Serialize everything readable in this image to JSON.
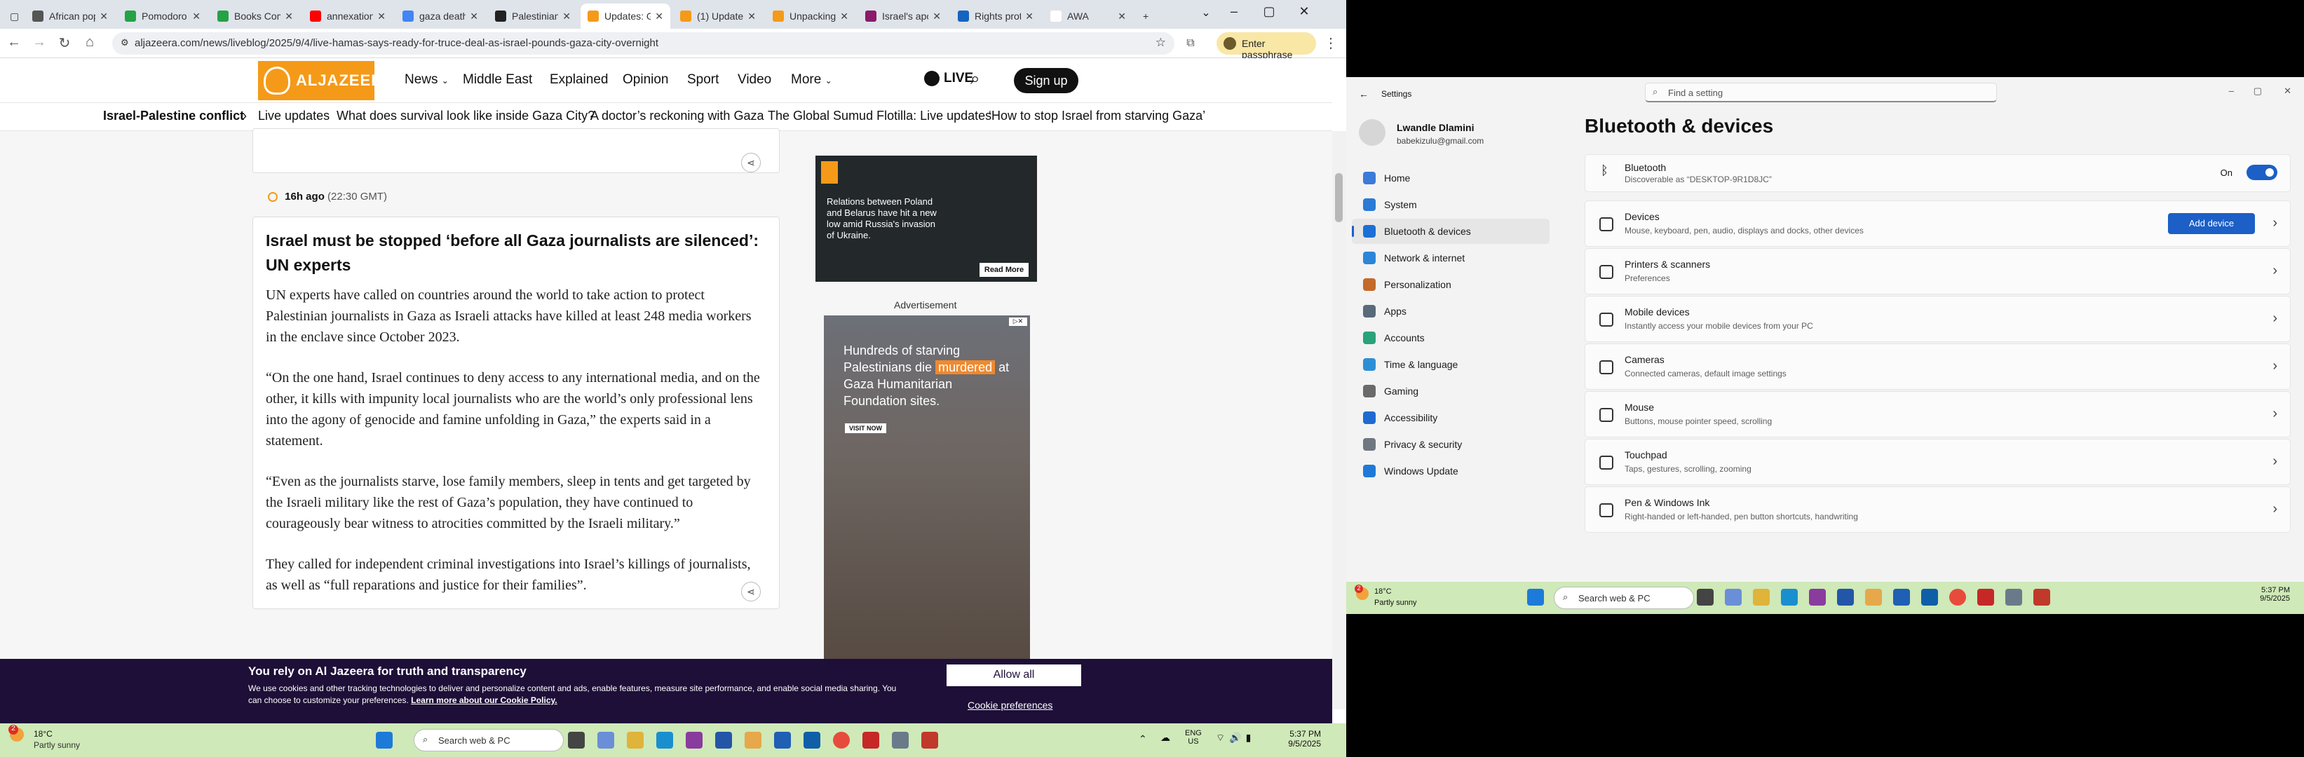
{
  "browser": {
    "tabs": [
      {
        "title": "African pop",
        "color": "#555"
      },
      {
        "title": "Pomodoro F",
        "color": "#25a244"
      },
      {
        "title": "Books Comp",
        "color": "#25a244"
      },
      {
        "title": "annexation",
        "color": "#ff0000"
      },
      {
        "title": "gaza death",
        "color": "#4285f4"
      },
      {
        "title": "Palestinian",
        "color": "#222"
      },
      {
        "title": "Updates: Ga",
        "color": "#f59a18"
      },
      {
        "title": "(1) Update",
        "color": "#f59a18"
      },
      {
        "title": "Unpacking t",
        "color": "#f59a18"
      },
      {
        "title": "Israel's apo",
        "color": "#8b1a6b"
      },
      {
        "title": "Rights prote",
        "color": "#1565c0"
      },
      {
        "title": "AWA",
        "color": "#ffffff"
      }
    ],
    "active_tab_index": 6,
    "url": "aljazeera.com/news/liveblog/2025/9/4/live-hamas-says-ready-for-truce-deal-as-israel-pounds-gaza-city-overnight",
    "passphrase_button": "Enter passphrase"
  },
  "header": {
    "logo_text": "ALJAZEERA",
    "nav": [
      "News",
      "Middle East",
      "Explained",
      "Opinion",
      "Sport",
      "Video",
      "More"
    ],
    "live_label": "LIVE",
    "signup_label": "Sign up"
  },
  "trending": {
    "label": "Israel-Palestine conflict",
    "links": [
      "Live updates",
      "What does survival look like inside Gaza City?",
      "A doctor’s reckoning with Gaza",
      "The Global Sumud Flotilla: Live updates",
      "‘How to stop Israel from starving Gaza’"
    ]
  },
  "post": {
    "time_ago": "16h ago",
    "time_gmt": "(22:30 GMT)",
    "title": "Israel must be stopped ‘before all Gaza journalists are silenced’: UN experts",
    "paragraphs": [
      "UN experts have called on countries around the world to take action to protect Palestinian journalists in Gaza as Israeli attacks have killed at least 248 media workers in the enclave since October 2023.",
      "“On the one hand, Israel continues to deny access to any international media, and on the other, it kills with impunity local journalists who are the world’s only professional lens into the agony of genocide and famine unfolding in Gaza,” the experts said in a statement.",
      "“Even as the journalists starve, lose family members, sleep in tents and get targeted by the Israeli military like the rest of Gaza’s population, they have continued to courageously bear witness to atrocities committed by the Israeli military.”",
      "They called for independent criminal investigations into Israel’s killings of journalists, as well as “full reparations and justice for their families”."
    ]
  },
  "ads": {
    "ad1_text": "Relations between Poland and Belarus have hit a new low amid Russia's invasion of Ukraine.",
    "ad1_button": "Read More",
    "label": "Advertisement",
    "ad2_pre": "Hundreds of starving Palestinians die",
    "ad2_highlight": "murdered",
    "ad2_post": "at Gaza Humanitarian Foundation sites.",
    "ad2_button": "VISIT NOW"
  },
  "cookie": {
    "title": "You rely on Al Jazeera for truth and transparency",
    "text": "We use cookies and other tracking technologies to deliver and personalize content and ads, enable features, measure site performance, and enable social media sharing. You can choose to customize your preferences.",
    "link": "Learn more about our Cookie Policy.",
    "allow_label": "Allow all",
    "prefs_label": "Cookie preferences"
  },
  "taskbar": {
    "weather_temp": "18°C",
    "weather_desc": "Partly sunny",
    "weather_badge": "2",
    "search_placeholder": "Search web & PC",
    "lang_top": "ENG",
    "lang_bottom": "US",
    "time": "5:37 PM",
    "date": "9/5/2025"
  },
  "settings": {
    "window_title": "Settings",
    "search_placeholder": "Find a setting",
    "user_name": "Lwandle Dlamini",
    "user_email": "babekizulu@gmail.com",
    "page_title": "Bluetooth & devices",
    "sidebar": [
      {
        "label": "Home",
        "color": "#3c7bd9"
      },
      {
        "label": "System",
        "color": "#2a7ad6"
      },
      {
        "label": "Bluetooth & devices",
        "color": "#1c6fd6"
      },
      {
        "label": "Network & internet",
        "color": "#2b86d8"
      },
      {
        "label": "Personalization",
        "color": "#c46a2a"
      },
      {
        "label": "Apps",
        "color": "#5a6a7a"
      },
      {
        "label": "Accounts",
        "color": "#2aa27a"
      },
      {
        "label": "Time & language",
        "color": "#2c8fd6"
      },
      {
        "label": "Gaming",
        "color": "#6a6a6a"
      },
      {
        "label": "Accessibility",
        "color": "#1f6ad1"
      },
      {
        "label": "Privacy & security",
        "color": "#6f7780"
      },
      {
        "label": "Windows Update",
        "color": "#1e7ad8"
      }
    ],
    "selected_index": 2,
    "bluetooth": {
      "title": "Bluetooth",
      "sub": "Discoverable as “DESKTOP-9R1D8JC”",
      "state": "On"
    },
    "rows": [
      {
        "title": "Devices",
        "sub": "Mouse, keyboard, pen, audio, displays and docks, other devices",
        "button": "Add device"
      },
      {
        "title": "Printers & scanners",
        "sub": "Preferences"
      },
      {
        "title": "Mobile devices",
        "sub": "Instantly access your mobile devices from your PC"
      },
      {
        "title": "Cameras",
        "sub": "Connected cameras, default image settings"
      },
      {
        "title": "Mouse",
        "sub": "Buttons, mouse pointer speed, scrolling"
      },
      {
        "title": "Touchpad",
        "sub": "Taps, gestures, scrolling, zooming"
      },
      {
        "title": "Pen & Windows Ink",
        "sub": "Right-handed or left-handed, pen button shortcuts, handwriting"
      }
    ]
  },
  "taskbar2": {
    "weather_temp": "18°C",
    "weather_desc": "Partly sunny",
    "weather_badge": "2",
    "search_placeholder": "Search web & PC",
    "time": "5:37 PM",
    "date": "9/5/2025"
  }
}
